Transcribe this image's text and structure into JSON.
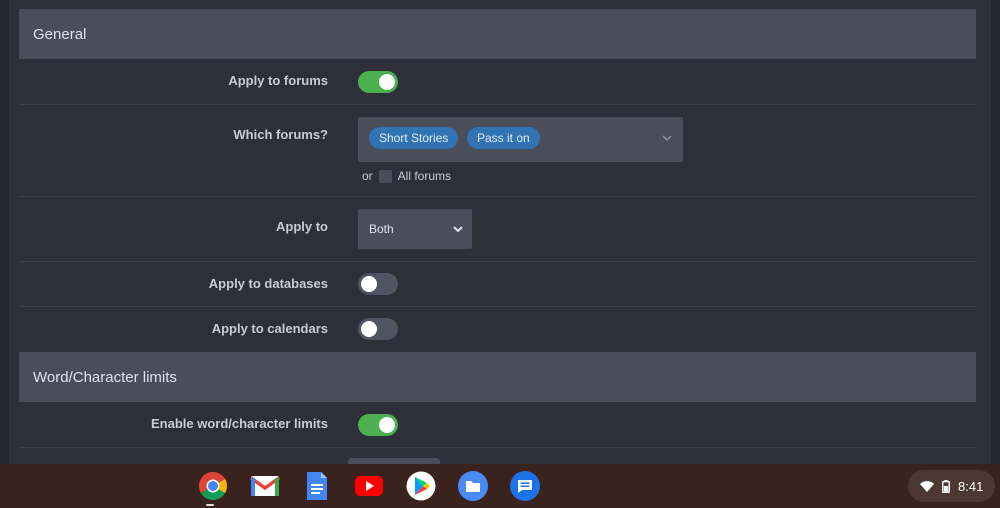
{
  "sections": {
    "general": "General",
    "limits": "Word/Character limits"
  },
  "rows": {
    "apply_forums": {
      "label": "Apply to forums",
      "enabled": true
    },
    "which_forums": {
      "label": "Which forums?",
      "tokens": [
        "Short Stories",
        "Pass it on"
      ],
      "or_text": "or",
      "all_forums_label": "All forums",
      "all_forums_checked": false
    },
    "apply_to": {
      "label": "Apply to",
      "value": "Both"
    },
    "apply_databases": {
      "label": "Apply to databases",
      "enabled": false
    },
    "apply_calendars": {
      "label": "Apply to calendars",
      "enabled": false
    },
    "enable_limits": {
      "label": "Enable word/character limits",
      "enabled": true
    }
  },
  "colors": {
    "toggle_on": "#4caf50",
    "toggle_off": "#4f5462",
    "token": "#3273b3",
    "section_header": "#4a4e5b",
    "shelf": "#3a231d"
  },
  "shelf": {
    "apps": [
      "chrome-icon",
      "gmail-icon",
      "docs-icon",
      "youtube-icon",
      "play-store-icon",
      "files-icon",
      "messages-icon"
    ],
    "time": "8:41"
  }
}
